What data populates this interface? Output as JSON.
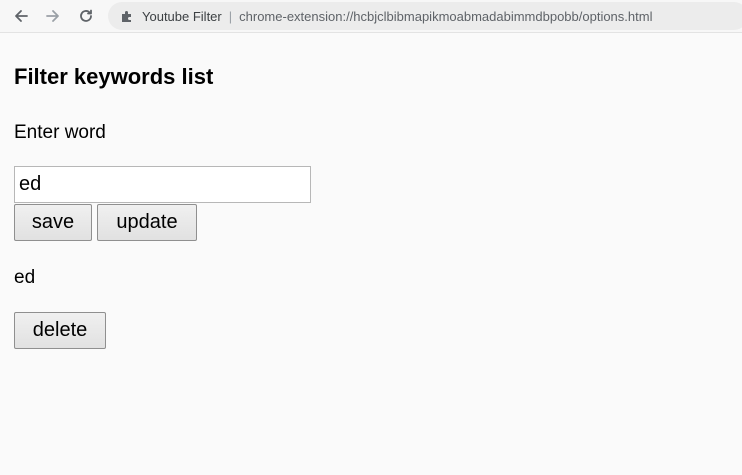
{
  "browser": {
    "site_name": "Youtube Filter",
    "separator": "|",
    "url": "chrome-extension://hcbjclbibmapikmoabmadabimmdbpobb/options.html",
    "icons": {
      "back": "arrow-left-icon",
      "forward": "arrow-right-icon",
      "reload": "reload-icon",
      "extension": "puzzle-piece-icon"
    }
  },
  "page": {
    "title": "Filter keywords list",
    "input_label": "Enter word",
    "input_value": "ed",
    "save_label": "save",
    "update_label": "update",
    "keywords": [
      {
        "word": "ed",
        "delete_label": "delete"
      }
    ]
  }
}
